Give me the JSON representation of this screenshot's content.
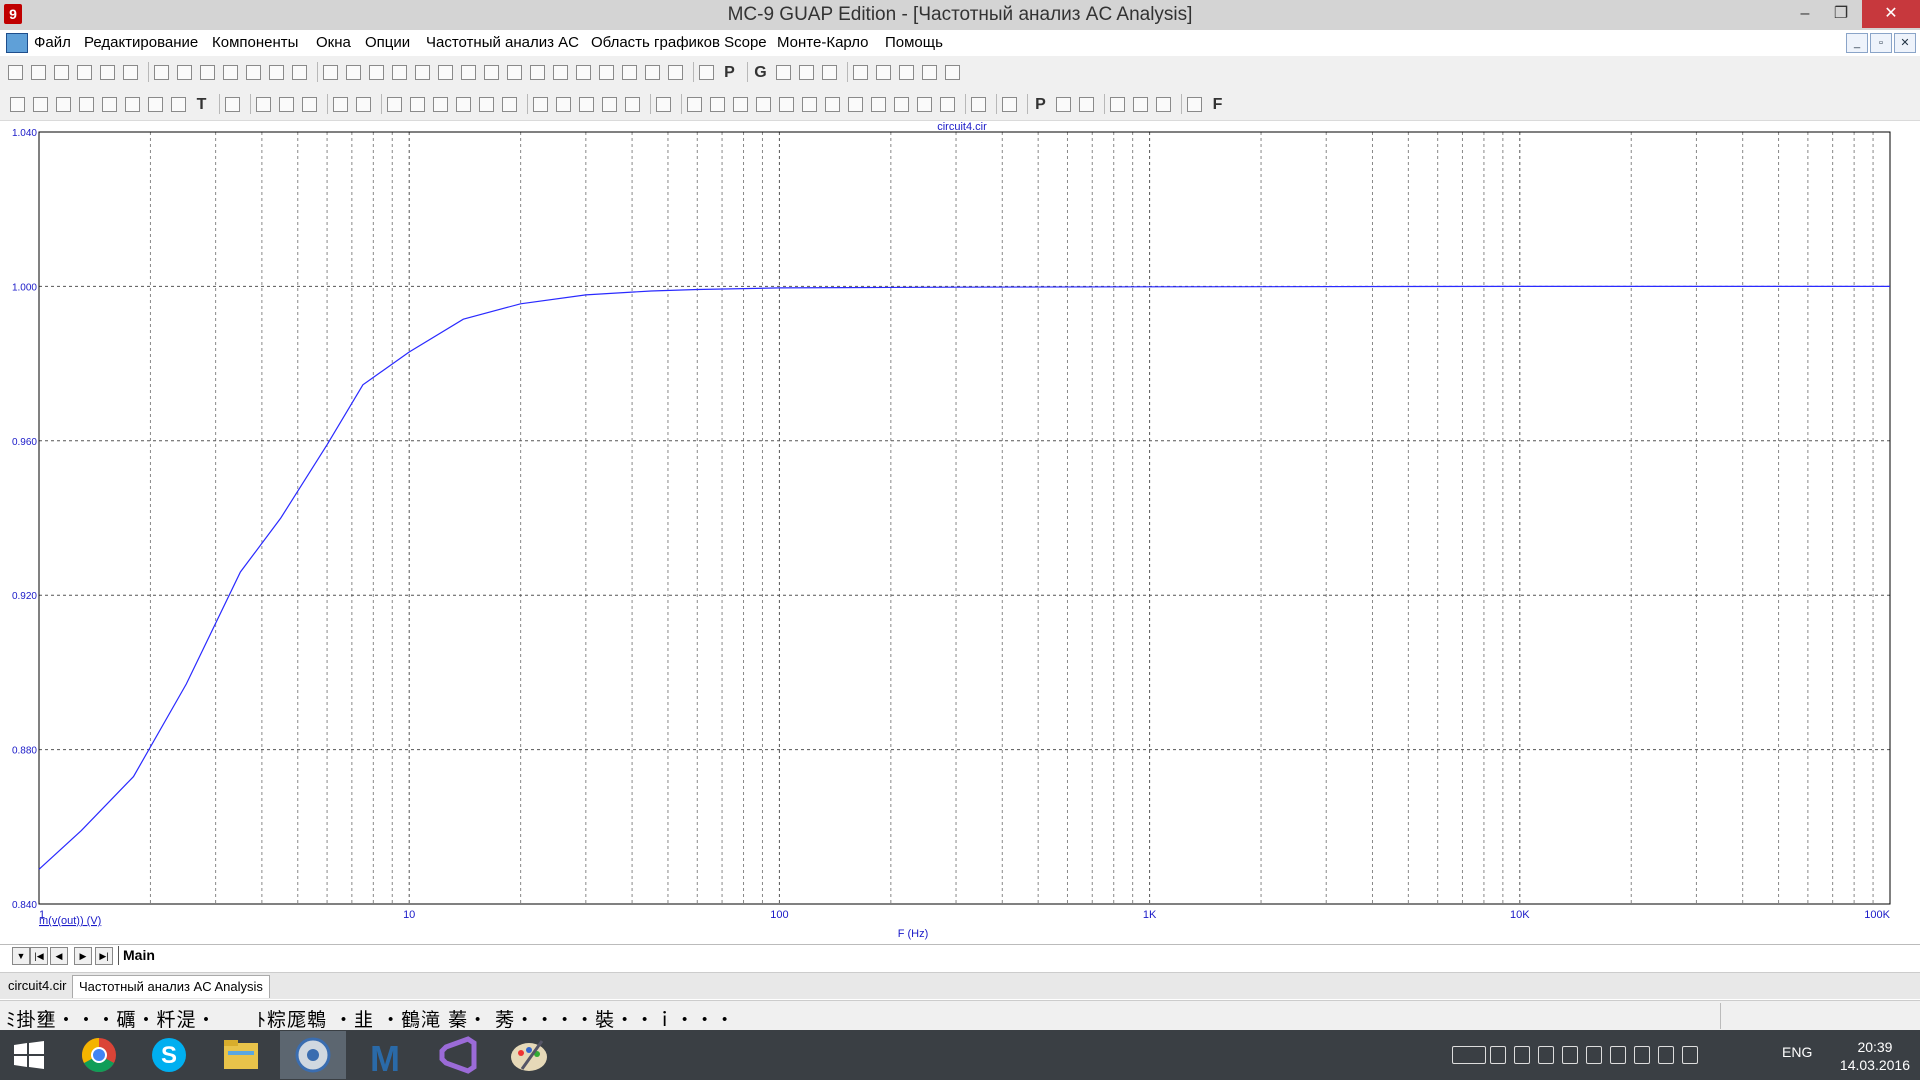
{
  "window": {
    "title": "MC-9 GUAP Edition - [Частотный анализ AC Analysis]",
    "minimize_glyph": "–",
    "maximize_glyph": "❐",
    "close_glyph": "✕"
  },
  "menu": {
    "items": [
      "Файл",
      "Редактирование",
      "Компоненты",
      "Окна",
      "Опции",
      "Частотный анализ AC",
      "Область графиков Scope",
      "Монте-Карло",
      "Помощь"
    ],
    "mdi_buttons": [
      "_",
      "▫",
      "✕"
    ]
  },
  "toolbar1": {
    "icons": [
      "new-file",
      "open",
      "save",
      "save-as",
      "print",
      "print-preview",
      "undo",
      "redo",
      "cut",
      "copy",
      "paste",
      "delete",
      "select-all",
      "component-1",
      "component-2",
      "component-3",
      "component-4",
      "component-5",
      "component-6",
      "component-7",
      "component-8",
      "component-9",
      "component-10",
      "component-11",
      "layout-1",
      "layout-2",
      "layout-3",
      "layout-4",
      "layout-5",
      "calculator",
      "P",
      "G",
      "grid",
      "table",
      "wave",
      "wire",
      "pencil",
      "edit",
      "text-scale",
      "probe"
    ]
  },
  "toolbar2": {
    "icons": [
      "arrow",
      "select",
      "scale",
      "scale2",
      "scale3",
      "scale4",
      "scale5",
      "scale6",
      "T",
      "cursor",
      "run",
      "stop",
      "pause",
      "line",
      "diag-line",
      "box",
      "grid",
      "grid2",
      "grid3",
      "grid4",
      "grid5",
      "split",
      "tool1",
      "tool2",
      "tool3",
      "tool4",
      "graph",
      "cursor-h",
      "cursor-v",
      "peak",
      "valley",
      "high",
      "low",
      "slope",
      "inflect",
      "min",
      "max",
      "peak2",
      "valley2",
      "settings",
      "table",
      "P",
      "tracker1",
      "tracker2",
      "zoom-in",
      "zoom-out",
      "zoom-fit",
      "color",
      "F"
    ]
  },
  "chart_data": {
    "type": "line",
    "title": "circuit4.cir",
    "xlabel": "F (Hz)",
    "ylabel": "m(v(out)) (V)",
    "x_scale": "log",
    "xlim": [
      1,
      100000
    ],
    "ylim": [
      0.84,
      1.04
    ],
    "x_ticks": [
      "1",
      "10",
      "100",
      "1K",
      "10K",
      "100K"
    ],
    "y_ticks": [
      "0.840",
      "0.880",
      "0.920",
      "0.960",
      "1.000",
      "1.040"
    ],
    "grid": true,
    "series": [
      {
        "name": "m(v(out)) (V)",
        "color": "#2a2aff",
        "x": [
          1,
          1.3,
          1.8,
          2.5,
          3.5,
          4.5,
          6,
          7.5,
          10,
          14,
          20,
          30,
          45,
          60,
          100,
          150,
          300,
          1000,
          10000,
          100000
        ],
        "y": [
          0.849,
          0.859,
          0.873,
          0.897,
          0.926,
          0.94,
          0.959,
          0.9745,
          0.983,
          0.9915,
          0.9955,
          0.9978,
          0.9988,
          0.9992,
          0.9996,
          0.9997,
          0.9998,
          0.9999,
          1.0,
          1.0
        ]
      }
    ]
  },
  "sheet_tabs": {
    "nav": [
      "▼",
      "|◀",
      "◀",
      "▶",
      "▶|"
    ],
    "main": "Main"
  },
  "doc_tabs": [
    "circuit4.cir",
    "Частотный анализ AC Analysis"
  ],
  "status": {
    "text": "ﾐ掛壅・・・礪・粁湜・　　ﾄ粽厖鵯 ・韭 ・鶴滝 蓁・ 莠・・・・裝・・ｉ・・・"
  },
  "taskbar": {
    "apps": [
      "windows-start",
      "chrome",
      "skype",
      "file-explorer",
      "microcap",
      "matlab",
      "visual-studio",
      "paint"
    ],
    "tray_icons": [
      "keyboard-icon",
      "chevron-up-icon",
      "flag-icon",
      "dropbox-icon",
      "steam-icon",
      "nvidia-icon",
      "e-icon",
      "battery-icon",
      "signal-icon",
      "volume-icon"
    ],
    "lang": "ENG",
    "time": "20:39",
    "date": "14.03.2016"
  }
}
